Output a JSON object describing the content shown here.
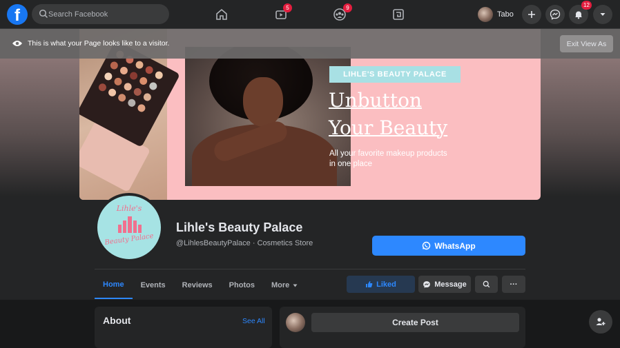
{
  "topbar": {
    "logo": "f",
    "search_placeholder": "Search Facebook",
    "nav": [
      {
        "name": "home-icon"
      },
      {
        "name": "watch-icon",
        "badge": "5"
      },
      {
        "name": "groups-icon",
        "badge": "9"
      },
      {
        "name": "gaming-icon"
      }
    ],
    "profile_name": "Tabo",
    "notifications_badge": "12"
  },
  "visitor_bar": {
    "text": "This is what your Page looks like to a visitor.",
    "exit_label": "Exit View As"
  },
  "cover": {
    "tag": "LIHLE'S BEAUTY PALACE",
    "headline_1": "Unbutton",
    "headline_2": "Your Beauty",
    "subline": "All your favorite makeup products in one place"
  },
  "profile_logo": {
    "top": "Lihle's",
    "bottom": "Beauty Palace"
  },
  "page": {
    "name": "Lihle's Beauty Palace",
    "handle": "@LihlesBeautyPalace · Cosmetics Store",
    "cta_label": "WhatsApp"
  },
  "tabs": [
    {
      "label": "Home",
      "active": true
    },
    {
      "label": "Events"
    },
    {
      "label": "Reviews"
    },
    {
      "label": "Photos"
    },
    {
      "label": "More"
    }
  ],
  "actions": {
    "liked": "Liked",
    "message": "Message",
    "more": "···"
  },
  "about": {
    "title": "About",
    "see_all": "See All"
  },
  "composer": {
    "create_post": "Create Post"
  },
  "colors": {
    "accent": "#2d88ff",
    "badge": "#e41e3f",
    "cover_pink": "#fbbec1",
    "tag_teal": "#a8e0e4"
  }
}
